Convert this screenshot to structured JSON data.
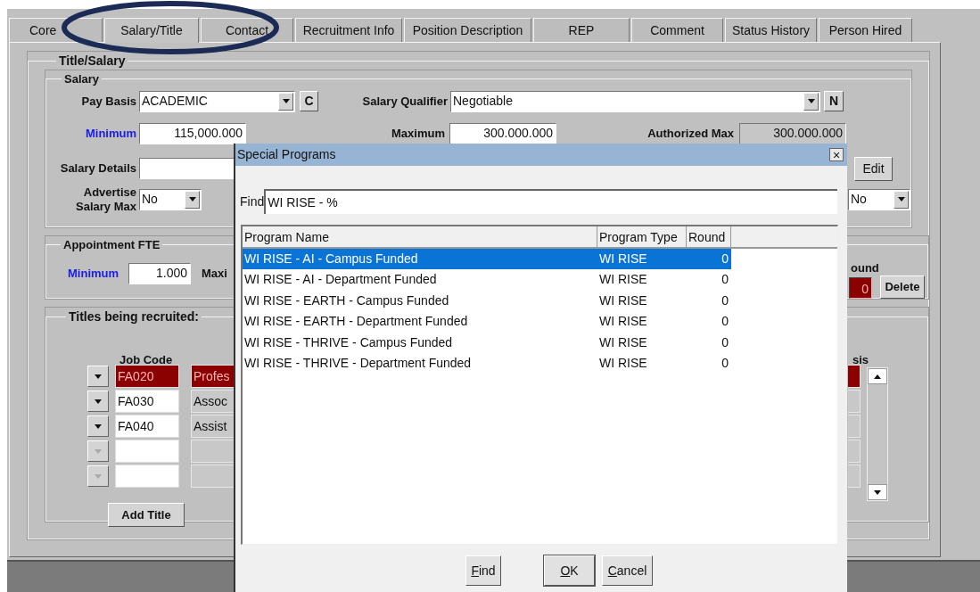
{
  "tabs": [
    {
      "label": "Core",
      "selected": false
    },
    {
      "label": "Salary/Title",
      "selected": true
    },
    {
      "label": "Contact",
      "selected": false
    },
    {
      "label": "Recruitment Info",
      "selected": false
    },
    {
      "label": "Position Description",
      "selected": false
    },
    {
      "label": "REP",
      "selected": false
    },
    {
      "label": "Comment",
      "selected": false
    },
    {
      "label": "Status History",
      "selected": false
    },
    {
      "label": "Person Hired",
      "selected": false
    }
  ],
  "title_salary": {
    "legend": "Title/Salary",
    "salary": {
      "legend": "Salary",
      "pay_basis": {
        "label": "Pay Basis",
        "value": "ACADEMIC",
        "button": "C"
      },
      "salary_qualifier": {
        "label": "Salary Qualifier",
        "value": "Negotiable",
        "button": "N"
      },
      "minimum": {
        "label": "Minimum",
        "value": "115,000.000"
      },
      "maximum": {
        "label": "Maximum",
        "value": "300.000.000"
      },
      "authorized_max": {
        "label": "Authorized Max",
        "value": "300.000.000"
      },
      "salary_details": {
        "label": "Salary Details"
      },
      "edit_button": "Edit",
      "advertise_salary_max": {
        "label": "Advertise Salary Max",
        "value": "No"
      },
      "select_right": {
        "value": "No"
      }
    },
    "appointment_fte": {
      "legend": "Appointment FTE",
      "minimum": {
        "label": "Minimum",
        "value": "1.000"
      },
      "maximum_label": "Maxi",
      "round_label": "ound",
      "round_value": "0",
      "delete_button": "Delete"
    },
    "titles": {
      "legend": "Titles being recruited:",
      "job_code_header": "Job Code",
      "column_header": "sis",
      "rows": [
        {
          "job_code": "FA020",
          "title": "Profes",
          "selected": true,
          "disabled": false
        },
        {
          "job_code": "FA030",
          "title": "Assoc",
          "selected": false,
          "disabled": false
        },
        {
          "job_code": "FA040",
          "title": "Assist",
          "selected": false,
          "disabled": false
        },
        {
          "selected": false,
          "disabled": true
        },
        {
          "selected": false,
          "disabled": true
        }
      ],
      "add_title_button": "Add Title"
    }
  },
  "dialog": {
    "title": "Special Programs",
    "close": "×",
    "find_label": "Find",
    "find_value": "WI RISE - %",
    "columns": [
      "Program Name",
      "Program Type",
      "Round"
    ],
    "rows": [
      {
        "name": "WI RISE - AI - Campus Funded",
        "type": "WI RISE",
        "round": "0",
        "selected": true
      },
      {
        "name": "WI RISE - AI - Department Funded",
        "type": "WI RISE",
        "round": "0",
        "selected": false
      },
      {
        "name": "WI RISE - EARTH - Campus Funded",
        "type": "WI RISE",
        "round": "0",
        "selected": false
      },
      {
        "name": "WI RISE - EARTH - Department Funded",
        "type": "WI RISE",
        "round": "0",
        "selected": false
      },
      {
        "name": "WI RISE - THRIVE - Campus Funded",
        "type": "WI RISE",
        "round": "0",
        "selected": false
      },
      {
        "name": "WI RISE - THRIVE - Department Funded",
        "type": "WI RISE",
        "round": "0",
        "selected": false
      }
    ],
    "buttons": [
      {
        "label": "Find"
      },
      {
        "label": "OK"
      },
      {
        "label": "Cancel"
      }
    ]
  }
}
